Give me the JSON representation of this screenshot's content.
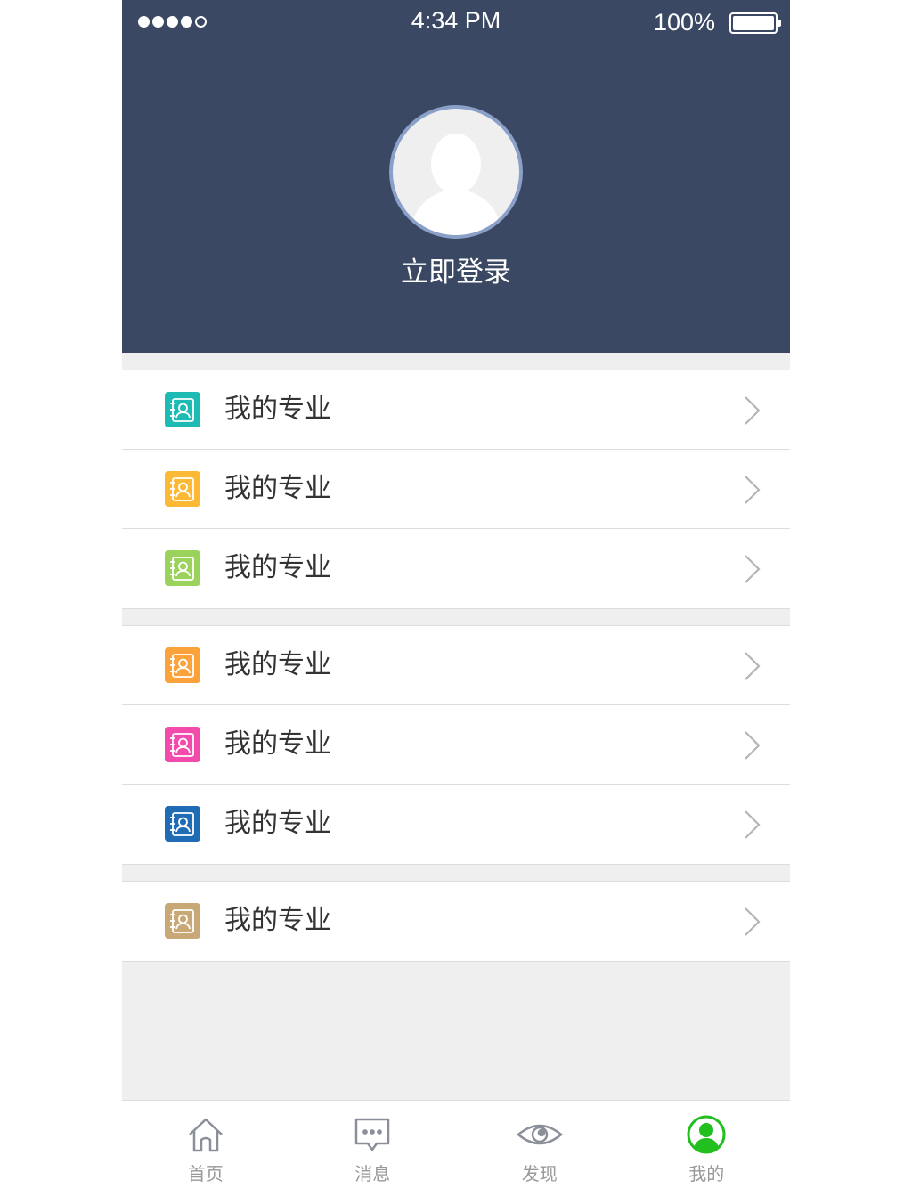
{
  "status_bar": {
    "time": "4:34 PM",
    "battery": "100%"
  },
  "header": {
    "login_label": "立即登录"
  },
  "sections": [
    {
      "items": [
        {
          "label": "我的专业",
          "color": "#1dbbb4",
          "icon": "contact-book-icon"
        },
        {
          "label": "我的专业",
          "color": "#fbb935",
          "icon": "contact-book-icon"
        },
        {
          "label": "我的专业",
          "color": "#9ad25b",
          "icon": "contact-book-icon"
        }
      ]
    },
    {
      "items": [
        {
          "label": "我的专业",
          "color": "#fca23a",
          "icon": "contact-book-icon"
        },
        {
          "label": "我的专业",
          "color": "#f24bac",
          "icon": "contact-book-icon"
        },
        {
          "label": "我的专业",
          "color": "#1f6cb5",
          "icon": "contact-book-icon"
        }
      ]
    },
    {
      "items": [
        {
          "label": "我的专业",
          "color": "#c9a877",
          "icon": "contact-book-icon"
        }
      ]
    }
  ],
  "tabbar": {
    "items": [
      {
        "label": "首页",
        "icon": "home-icon",
        "active": false
      },
      {
        "label": "消息",
        "icon": "message-icon",
        "active": false
      },
      {
        "label": "发现",
        "icon": "eye-icon",
        "active": false
      },
      {
        "label": "我的",
        "icon": "user-circle-icon",
        "active": true,
        "accent": "#22c01f"
      }
    ]
  }
}
